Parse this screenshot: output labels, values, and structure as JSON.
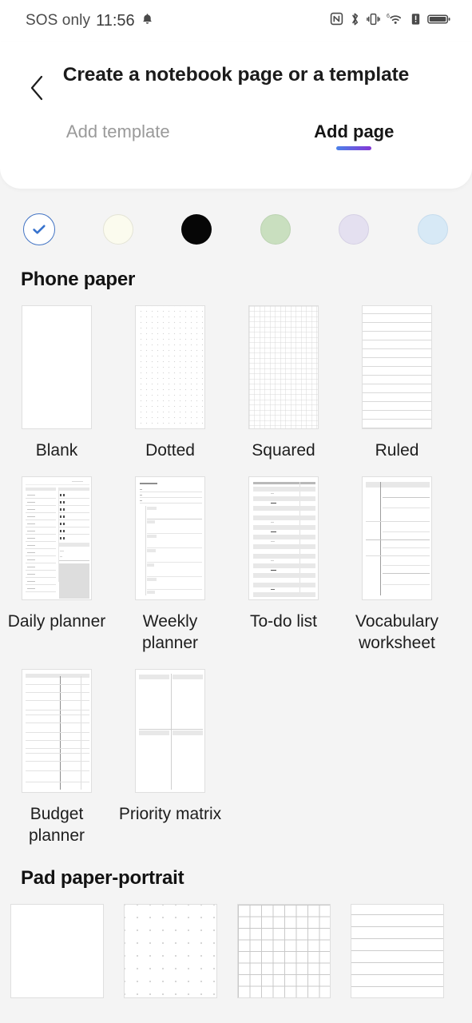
{
  "statusbar": {
    "carrier": "SOS only",
    "time": "11:56",
    "icons": [
      "bell-icon",
      "nfc-icon",
      "bluetooth-icon",
      "vibrate-icon",
      "wifi-6-icon",
      "alert-icon",
      "battery-icon"
    ]
  },
  "header": {
    "back_icon": "chevron-left-icon",
    "title": "Create a notebook page or a template",
    "tabs": [
      {
        "label": "Add template",
        "active": false
      },
      {
        "label": "Add page",
        "active": true
      }
    ],
    "active_underline_gradient": [
      "#4b82e8",
      "#8437d6"
    ]
  },
  "colors": {
    "selected_index": 0,
    "check_color": "#3873cd",
    "selected_ring": "#4173c4",
    "swatches": [
      {
        "name": "white",
        "hex": "#ffffff",
        "selected": true
      },
      {
        "name": "cream",
        "hex": "#fbfbee",
        "selected": false
      },
      {
        "name": "black",
        "hex": "#060606",
        "selected": false
      },
      {
        "name": "green",
        "hex": "#c9dfbf",
        "selected": false
      },
      {
        "name": "lavender",
        "hex": "#e4e0f0",
        "selected": false
      },
      {
        "name": "blue",
        "hex": "#d7e9f6",
        "selected": false
      }
    ]
  },
  "sections": [
    {
      "title": "Phone paper",
      "items": [
        {
          "label": "Blank",
          "pattern": "blank"
        },
        {
          "label": "Dotted",
          "pattern": "dotted"
        },
        {
          "label": "Squared",
          "pattern": "squared"
        },
        {
          "label": "Ruled",
          "pattern": "ruled"
        },
        {
          "label": "Daily planner",
          "pattern": "daily-planner"
        },
        {
          "label": "Weekly planner",
          "pattern": "weekly-planner"
        },
        {
          "label": "To-do list",
          "pattern": "todo-list"
        },
        {
          "label": "Vocabulary worksheet",
          "pattern": "vocabulary-worksheet"
        },
        {
          "label": "Budget planner",
          "pattern": "budget-planner"
        },
        {
          "label": "Priority matrix",
          "pattern": "priority-matrix"
        }
      ]
    },
    {
      "title": "Pad paper-portrait",
      "items": [
        {
          "label": "",
          "pattern": "blank"
        },
        {
          "label": "",
          "pattern": "dotted"
        },
        {
          "label": "",
          "pattern": "squared"
        },
        {
          "label": "",
          "pattern": "ruled"
        }
      ]
    }
  ]
}
